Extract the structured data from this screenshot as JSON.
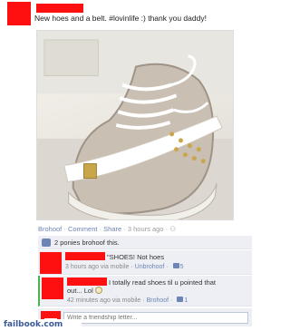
{
  "post": {
    "text": "New hoes and a belt. #lovinlife :) thank you daddy!"
  },
  "actions": {
    "like": "Brohoof",
    "comment": "Comment",
    "share": "Share",
    "time": "3 hours ago"
  },
  "likes": {
    "text": "2 ponies brohoof this."
  },
  "comments": [
    {
      "text": "\"SHOES! Not hoes",
      "time": "3 hours ago via mobile",
      "action": "Unbrohoof",
      "likes": "5"
    },
    {
      "text_line1": "I totally read shoes til u pointed that",
      "text_line2": "out... Lol",
      "time": "42 minutes ago via mobile",
      "action": "Brohoof",
      "likes": "1"
    }
  ],
  "write": {
    "placeholder": "Write a friendship letter..."
  },
  "footer": {
    "site": "failbook.com"
  },
  "colors": {
    "redaction": "#ff1010",
    "link": "#6d84b4",
    "comment_bg": "#edeff4"
  },
  "icons": {
    "like": "thumbs-up-icon",
    "emoji": "smiley-icon",
    "privacy": "people-icon"
  }
}
